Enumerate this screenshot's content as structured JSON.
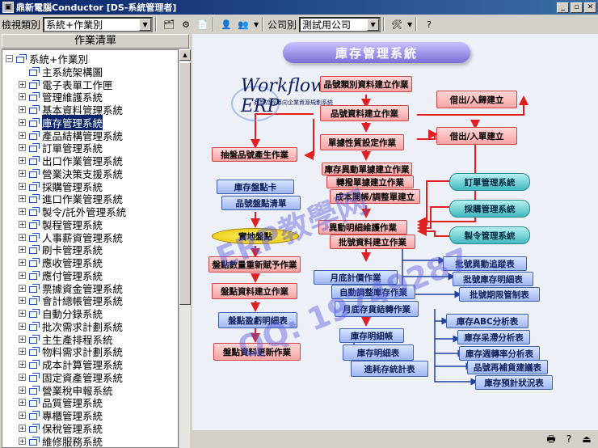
{
  "window": {
    "title": "鼎新電腦Conductor [DS-系統管理者]",
    "buttons": {
      "minimize": "_",
      "restore": "▫",
      "close": "✕"
    }
  },
  "toolbar": {
    "view_label": "檢視類別",
    "view_value": "系統+作業別",
    "company_label": "公司別",
    "company_value": "測試用公司"
  },
  "sidebar": {
    "header": "作業清單",
    "root": "系統+作業別",
    "items": [
      "主系統架構圖",
      "電子表單工作匣",
      "管理維護系統",
      "基本資料管理系統",
      "庫存管理系統",
      "產品結構管理系統",
      "訂單管理系統",
      "出口作業管理系統",
      "營業決策支援系統",
      "採購管理系統",
      "進口作業管理系統",
      "製令/託外管理系統",
      "製程管理系統",
      "人事薪資管理系統",
      "刷卡管理系統",
      "應收管理系統",
      "應付管理系統",
      "票據資金管理系統",
      "會計總帳管理系統",
      "自動分錄系統",
      "批次需求計劃系統",
      "主生產排程系統",
      "物料需求計劃系統",
      "成本計算管理系統",
      "固定資產管理系統",
      "營業稅申報系統",
      "品質管理系統",
      "專櫃管理系統",
      "保稅管理系統",
      "維修服務系統"
    ],
    "selected_index": 4
  },
  "diagram": {
    "banner": "庫存管理系統",
    "logo_text": "Workflow ERP",
    "logo_sub": "鼎新流程導向企業資源規劃系統",
    "watermark1": "ERP教學网",
    "watermark2": "QQ: 19749287",
    "left_column": [
      "抽盤品號產生作業",
      "庫存盤點卡",
      "品號盤點清單",
      "實地盤點",
      "盤點數量重新賦予作業",
      "盤點資料建立作業",
      "盤點盈虧明細表",
      "盤點資料更新作業"
    ],
    "center_column": [
      "品號類別資料建立作業",
      "品號資料建立作業",
      "單據性質設定作業",
      "庫存異動單據建立作業",
      "轉撥單據建立作業",
      "成本開帳/調整單建立",
      "異動明細維護作業",
      "批號資料建立作業",
      "月底計價作業",
      "自動調整庫存作業",
      "月底存貨結轉作業",
      "庫存明細帳",
      "庫存明細表",
      "進耗存統計表"
    ],
    "right_top": [
      "借出/入歸建立",
      "借出/入單建立"
    ],
    "right_systems": [
      "訂單管理系統",
      "採購管理系統",
      "製令管理系統"
    ],
    "right_lots": [
      "批號異動追蹤表",
      "批號庫存明細表",
      "批號期限管制表"
    ],
    "right_reports": [
      "庫存ABC分析表",
      "庫存呆滯分析表",
      "庫存週轉率分析表",
      "品號再補貨建議表",
      "庫存預計狀況表"
    ]
  }
}
